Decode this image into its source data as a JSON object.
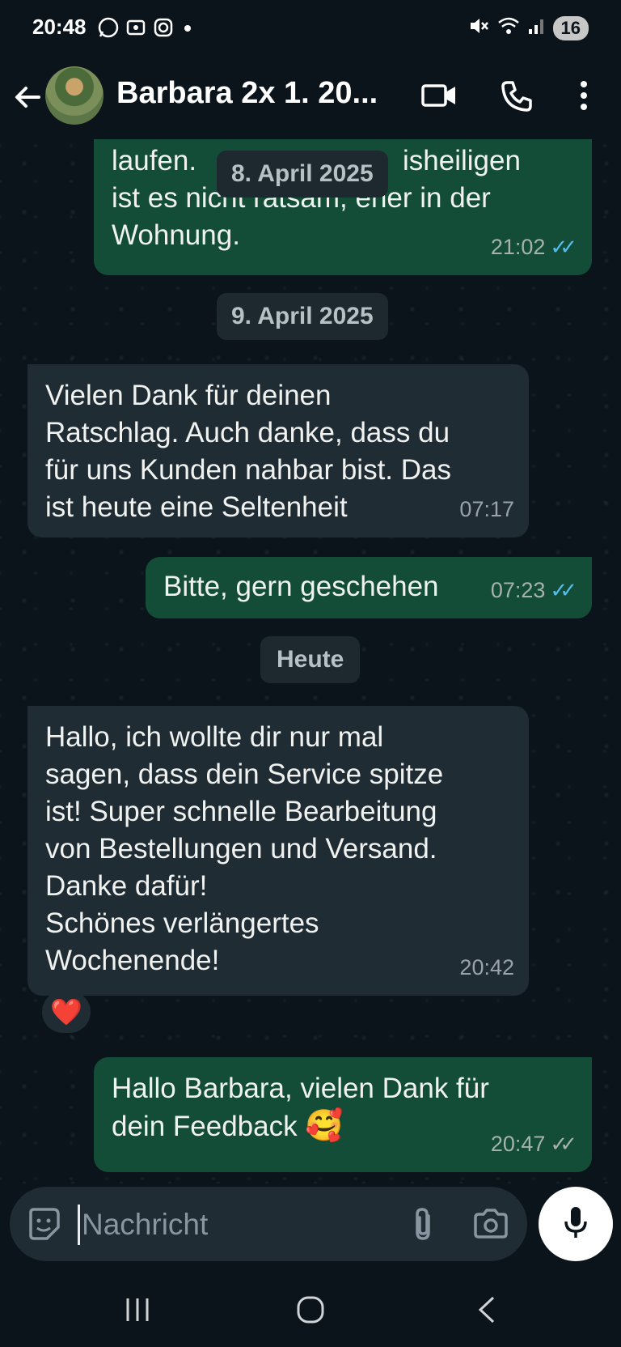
{
  "status_bar": {
    "time": "20:48",
    "battery": "16"
  },
  "header": {
    "contact_name": "Barbara 2x 1. 20..."
  },
  "chat": {
    "messages": [
      {
        "direction": "out",
        "text": "laufen.",
        "text_after": "isheiligen\nist es nicht ratsam, eher in der\nWohnung.",
        "time": "21:02",
        "status": "read"
      },
      {
        "direction": "in",
        "text": "Vielen Dank für deinen\nRatschlag. Auch danke, dass du\nfür uns Kunden nahbar bist. Das\nist heute eine Seltenheit",
        "time": "07:17"
      },
      {
        "direction": "out",
        "text": "Bitte, gern geschehen",
        "time": "07:23",
        "status": "read"
      },
      {
        "direction": "in",
        "text": "Hallo, ich wollte dir nur mal\nsagen, dass dein Service spitze\nist! Super schnelle Bearbeitung\nvon Bestellungen und Versand.\nDanke dafür!\nSchönes verlängertes\nWochenende!",
        "time": "20:42",
        "reaction": "❤️"
      },
      {
        "direction": "out",
        "text": "Hallo Barbara, vielen Dank für\ndein Feedback",
        "emoji": "🥰",
        "time": "20:47",
        "status": "sent"
      }
    ],
    "date_separators": [
      "8. April 2025",
      "9. April 2025",
      "Heute"
    ]
  },
  "input": {
    "placeholder": "Nachricht"
  },
  "colors": {
    "outgoing_bubble": "#134d37",
    "incoming_bubble": "#202c33",
    "background": "#0b141a",
    "read_ticks": "#53bdeb"
  },
  "icons": [
    "whatsapp-icon",
    "screenshot-icon",
    "instagram-icon",
    "mute-icon",
    "wifi-icon",
    "signal-icon",
    "back-arrow-icon",
    "video-call-icon",
    "phone-icon",
    "more-options-icon",
    "sticker-icon",
    "attach-icon",
    "camera-icon",
    "mic-icon",
    "recent-apps-icon",
    "home-icon",
    "nav-back-icon"
  ]
}
